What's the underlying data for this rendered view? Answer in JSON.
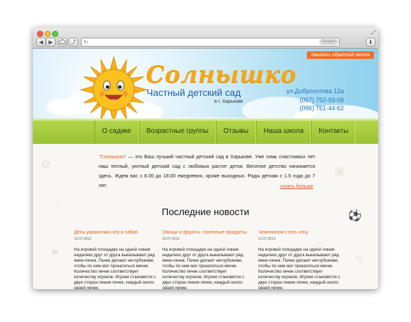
{
  "browser": {
    "reader_label": "Reader",
    "back_glyph": "◀",
    "forward_glyph": "▶",
    "share_glyph": "⤴",
    "refresh_glyph": "↻",
    "download_glyph": "⬇"
  },
  "header": {
    "callback_label": "Заказать обратный звонок",
    "title": "Солнышко",
    "subtitle": "Частный детский сад",
    "city": "в г. Харькове",
    "address": "ул.Доброхотова 12а",
    "phone1": "(057) 752-93-09",
    "phone2": "(096) 761-44-62"
  },
  "menu": {
    "items": [
      {
        "label": "О садике"
      },
      {
        "label": "Возрастные группы"
      },
      {
        "label": "Отзывы"
      },
      {
        "label": "Наша школа"
      },
      {
        "label": "Контакты"
      }
    ]
  },
  "intro": {
    "highlight": "\"Солнышко\"",
    "text": " — это Ваш лучший частный детский сад в Харькове. Уже семь счастливых лет наш теплый, уютный детский сад с любовью растит деток. Веселое детство начинается здесь. Ждем вас с 8.00 до 18.00 ежедневно, кроме выходных. Рады деткам с 1.5 года до 7 лет.",
    "more_label": "узнать больше"
  },
  "news": {
    "title": "Последние новости",
    "items": [
      {
        "headline": "День украинских игр и забав",
        "date": "19.07.2013",
        "body": "На игровой площадке на одной линии недалеко друг от друга выкапывают ряд ямок-печек. Печки делают неглубокими, чтобы по ним мог прокатиться мячик. Количество печек соответствует количеству игроков. Игроки становятся с двух сторон линии печек, каждый около своей печки."
      },
      {
        "headline": "Овощи и фрукты- полезные продукты",
        "date": "20.07.2013",
        "body": "На игровой площадке на одной линии недалеко друг от друга выкапывают ряд ямок-печек. Печки делают неглубокими, чтобы по ним мог прокатиться мячик. Количество печек соответствует количеству игроков. Игроки становятся с двух сторон линии печек, каждый около своей печки."
      },
      {
        "headline": "Чемпионом стать хочу",
        "date": "21.07.2013",
        "body": "На игровой площадке на одной линии недалеко друг от друга выкапывают ряд ямок-печек. Печки делают неглубокими, чтобы по ним мог прокатиться мячик. Количество печек соответствует количеству игроков. Игроки становятся с двух сторон линии печек, каждый около своей печки."
      }
    ]
  },
  "colors": {
    "accent_orange": "#ee6e26",
    "title_yellow": "#f4a818",
    "menu_green": "#a8cf3e",
    "link_blue": "#2874b7"
  }
}
